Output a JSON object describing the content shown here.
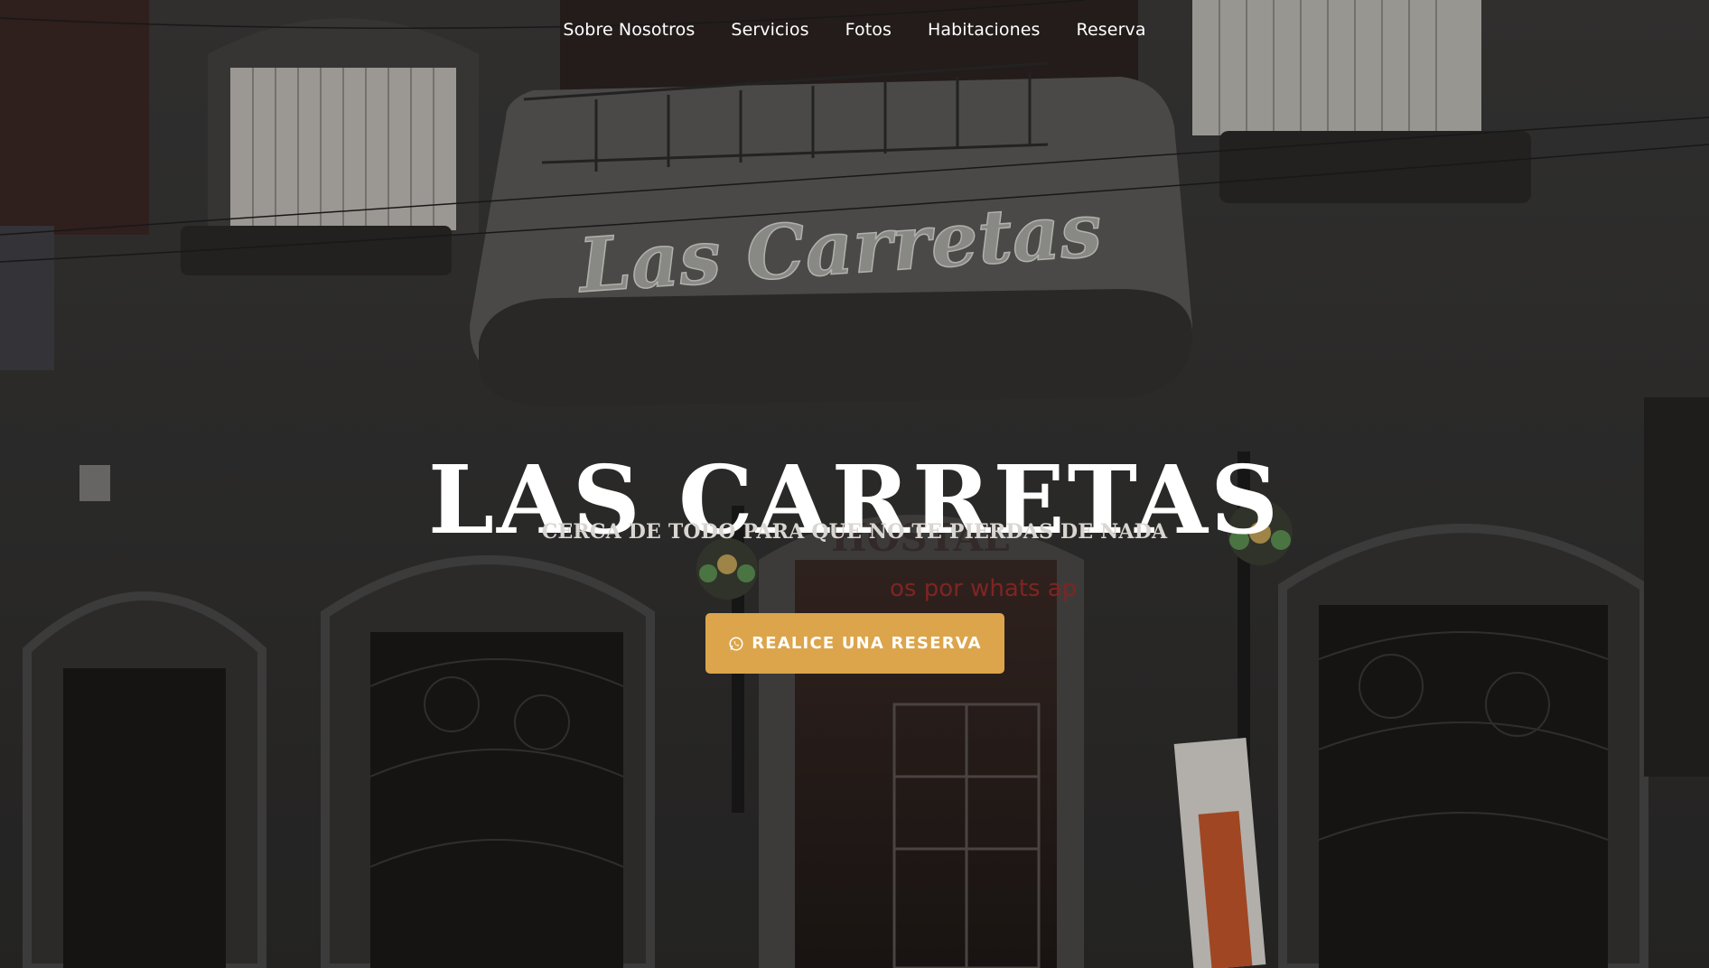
{
  "nav": {
    "items": [
      {
        "label": "Sobre Nosotros"
      },
      {
        "label": "Servicios"
      },
      {
        "label": "Fotos"
      },
      {
        "label": "Habitaciones"
      },
      {
        "label": "Reserva"
      }
    ]
  },
  "hero": {
    "title": "LAS CARRETAS",
    "subtitle": "CERCA DE TODO PARA QUE NO TE PIERDAS DE NADA",
    "cta": {
      "label": "REALICE UNA RESERVA",
      "icon": "whatsapp-icon"
    },
    "sign_text": "Las Carretas",
    "sign_secondary": "HOSTAL",
    "neon_text": "os por whats ap"
  },
  "colors": {
    "accent": "#dca54c",
    "text_primary": "#ffffff",
    "text_secondary": "#d9d6d2",
    "background": "#2f2e2e"
  }
}
